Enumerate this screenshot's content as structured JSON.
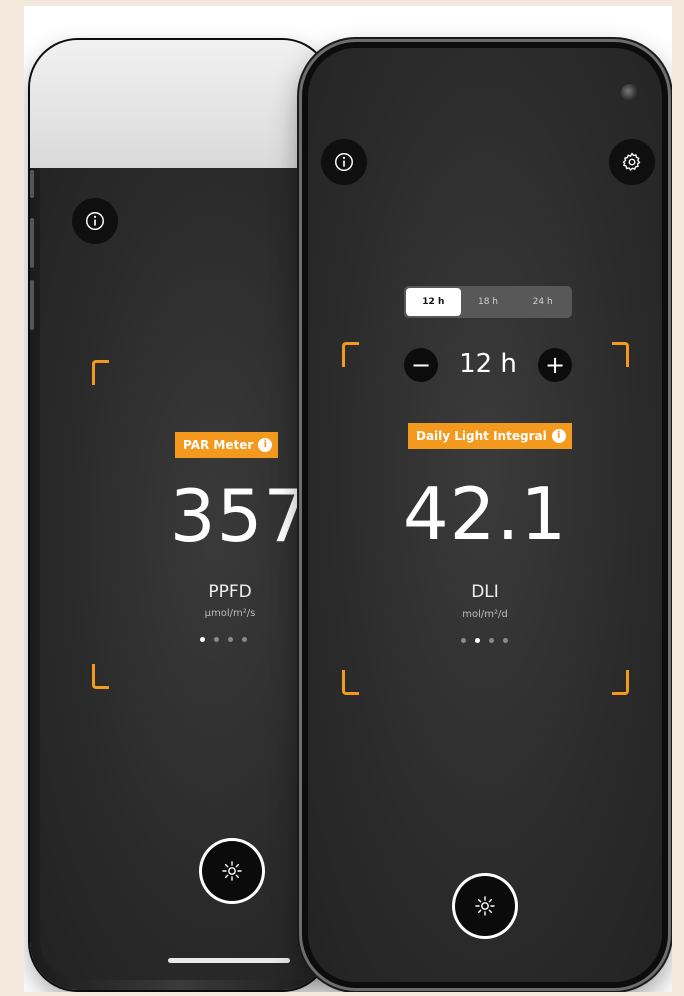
{
  "colors": {
    "accent": "#f39a1e",
    "screen_bg": "#2c2c2c",
    "page_bg": "#f3e9dc"
  },
  "back_phone": {
    "info_icon": "info-icon",
    "badge_label": "PAR Meter",
    "badge_icon": "info-icon",
    "value": "357",
    "unit": "PPFD",
    "unit_sub": "µmol/m²/s",
    "pager": {
      "count": 4,
      "active_index": 0
    },
    "shutter_icon": "sun-icon"
  },
  "front_phone": {
    "info_icon": "info-icon",
    "settings_icon": "gear-icon",
    "segments": [
      "12 h",
      "18 h",
      "24 h"
    ],
    "selected_segment": "12 h",
    "stepper": {
      "minus": "−",
      "value": "12 h",
      "plus": "+"
    },
    "badge_label": "Daily Light Integral",
    "badge_icon": "info-icon",
    "value": "42.1",
    "unit": "DLI",
    "unit_sub": "mol/m²/d",
    "pager": {
      "count": 4,
      "active_index": 1
    },
    "shutter_icon": "sun-icon"
  }
}
